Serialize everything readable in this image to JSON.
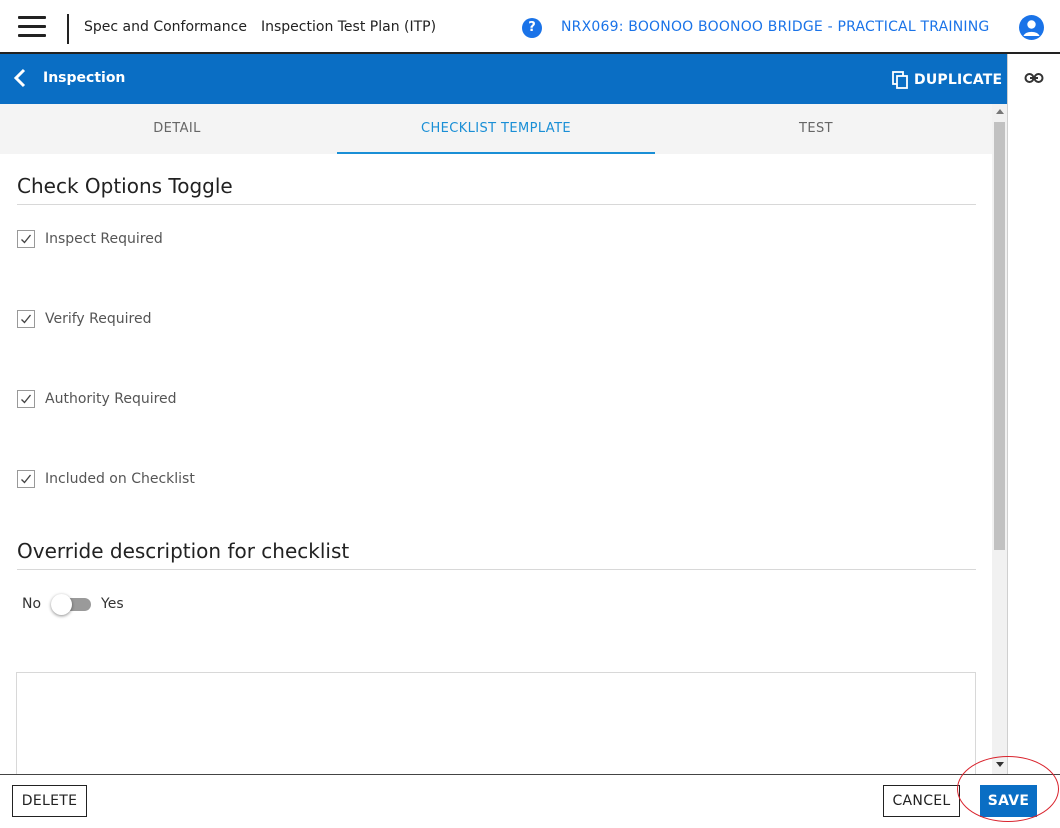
{
  "topbar": {
    "module": "Spec and Conformance",
    "page": "Inspection Test Plan (ITP)",
    "help_icon": "?",
    "project": "NRX069: BOONOO BOONOO BRIDGE - PRACTICAL TRAINING"
  },
  "panel": {
    "title": "Inspection",
    "duplicate_label": "DUPLICATE"
  },
  "tabs": [
    {
      "label": "DETAIL",
      "active": false
    },
    {
      "label": "CHECKLIST TEMPLATE",
      "active": true
    },
    {
      "label": "TEST",
      "active": false
    }
  ],
  "check_options": {
    "title": "Check Options Toggle",
    "items": [
      {
        "label": "Inspect Required",
        "checked": true
      },
      {
        "label": "Verify Required",
        "checked": true
      },
      {
        "label": "Authority Required",
        "checked": true
      },
      {
        "label": "Included on Checklist",
        "checked": true
      }
    ]
  },
  "override": {
    "title": "Override description for checklist",
    "toggle_off_label": "No",
    "toggle_on_label": "Yes",
    "toggle_value": false,
    "text_value": ""
  },
  "footer": {
    "delete_label": "DELETE",
    "cancel_label": "CANCEL",
    "save_label": "SAVE"
  },
  "colors": {
    "brand_blue": "#0a6ec4",
    "link_blue": "#1a73e8",
    "active_tab": "#1a8fd6",
    "highlight_red": "#d9232d"
  }
}
